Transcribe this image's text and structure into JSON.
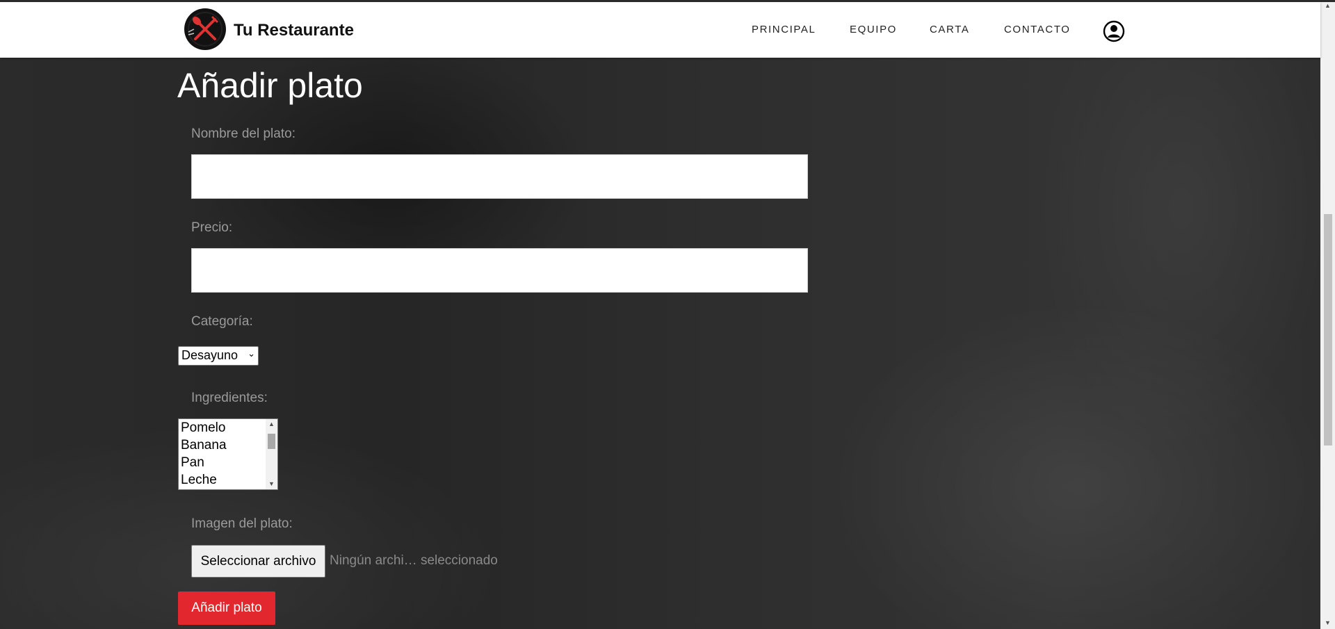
{
  "header": {
    "brand": "Tu Restaurante",
    "nav": [
      "PRINCIPAL",
      "EQUIPO",
      "CARTA",
      "CONTACTO"
    ]
  },
  "form": {
    "title": "Añadir plato",
    "name_label": "Nombre del plato:",
    "price_label": "Precio:",
    "category_label": "Categoría:",
    "category_selected": "Desayuno",
    "ingredients_label": "Ingredientes:",
    "ingredients": [
      "Pomelo",
      "Banana",
      "Pan",
      "Leche"
    ],
    "image_label": "Imagen del plato:",
    "file_button": "Seleccionar archivo",
    "file_status": "Ningún archi… seleccionado",
    "submit": "Añadir plato"
  },
  "colors": {
    "accent": "#e3272f",
    "background": "#2a2a2a"
  },
  "icons": [
    "restaurant-logo",
    "user-account-icon"
  ]
}
